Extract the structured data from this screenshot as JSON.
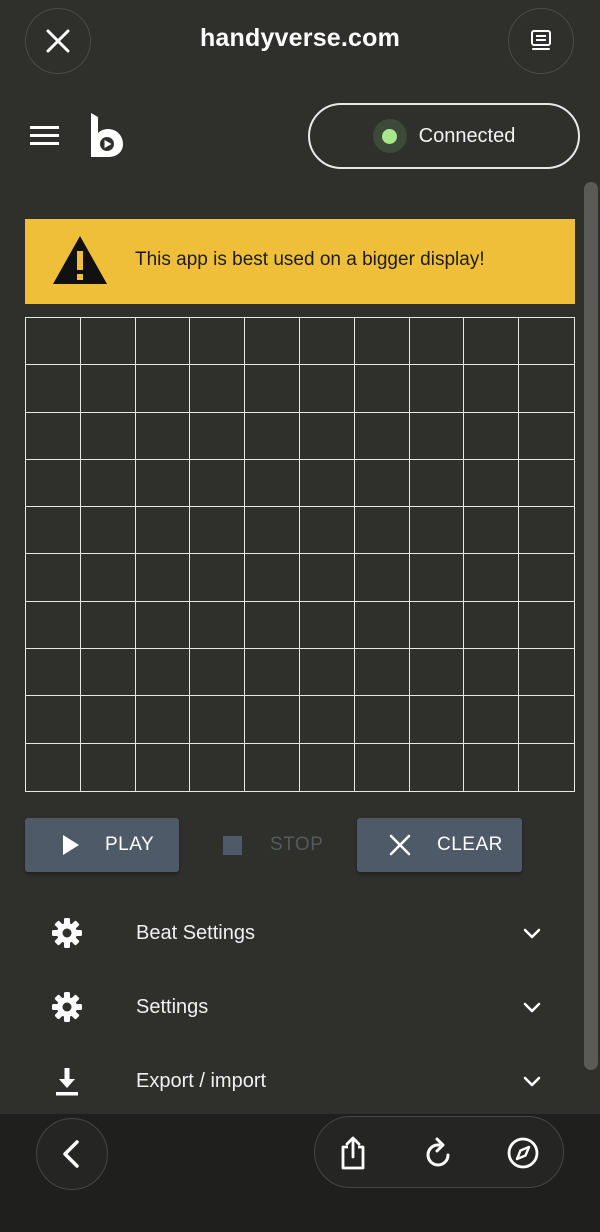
{
  "browser": {
    "title": "handyverse.com",
    "close_icon": "close-icon",
    "tabs_icon": "tabs-icon"
  },
  "app": {
    "menu_icon": "hamburger-menu-icon",
    "logo_icon": "handyverse-logo-icon",
    "status": {
      "label": "Connected",
      "color": "#a6e88a"
    }
  },
  "banner": {
    "icon": "warning-icon",
    "text": "This app is best used on a bigger display!",
    "color": "#f0bf39"
  },
  "grid": {
    "rows": 10,
    "columns": 10
  },
  "controls": {
    "play_label": "PLAY",
    "stop_label": "STOP",
    "clear_label": "CLEAR"
  },
  "accordion": [
    {
      "label": "Beat Settings",
      "icon": "gear-icon"
    },
    {
      "label": "Settings",
      "icon": "gear-icon"
    },
    {
      "label": "Export / import",
      "icon": "download-icon"
    }
  ],
  "bottom_toolbar": {
    "back_icon": "back-icon",
    "share_icon": "share-icon",
    "reload_icon": "reload-icon",
    "compass_icon": "compass-icon"
  }
}
